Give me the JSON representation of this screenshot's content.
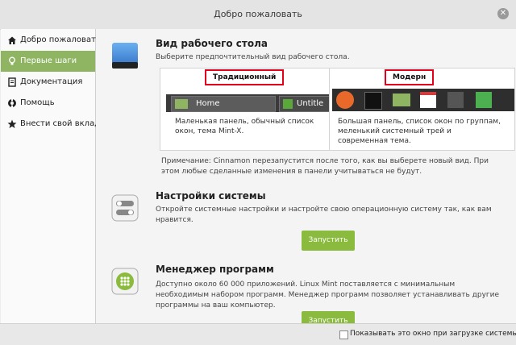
{
  "window": {
    "title": "Добро пожаловать"
  },
  "sidebar": {
    "items": [
      {
        "label": "Добро пожаловать",
        "icon": "home-icon"
      },
      {
        "label": "Первые шаги",
        "icon": "lightbulb-icon",
        "active": true
      },
      {
        "label": "Документация",
        "icon": "book-icon"
      },
      {
        "label": "Помощь",
        "icon": "lifebuoy-icon"
      },
      {
        "label": "Внести свой вклад",
        "icon": "star-icon"
      }
    ]
  },
  "desktop_layout": {
    "title": "Вид рабочего стола",
    "subtitle": "Выберите предпочтительный вид рабочего стола.",
    "traditional": {
      "title": "Традиционный",
      "taskbar_items": [
        "Home",
        "Untitle"
      ],
      "desc": "Маленькая панель, обычный список окон, тема Mint-X."
    },
    "modern": {
      "title": "Модерн",
      "desc": "Большая панель, список окон по группам, меленький системный трей и современная тема."
    },
    "note": "Примечание: Cinnamon перезапустится после того, как вы выберете новый вид. При этом любые сделанные изменения в панели учитываться не будут."
  },
  "system_settings": {
    "title": "Настройки системы",
    "desc": "Откройте системные настройки и настройте свою операционную систему так, как вам нравится.",
    "button": "Запустить"
  },
  "software_manager": {
    "title": "Менеджер программ",
    "desc": "Доступно около 60 000 приложений. Linux Mint поставляется с минимальным необходимым набором программ. Менеджер программ позволяет устанавливать другие программы на ваш компьютер.",
    "button": "Запустить"
  },
  "footer": {
    "checkbox_label": "Показывать это окно при загрузке системы"
  },
  "colors": {
    "accent": "#8fb563",
    "button": "#8bbb3e",
    "highlight_border": "#e3001b"
  }
}
